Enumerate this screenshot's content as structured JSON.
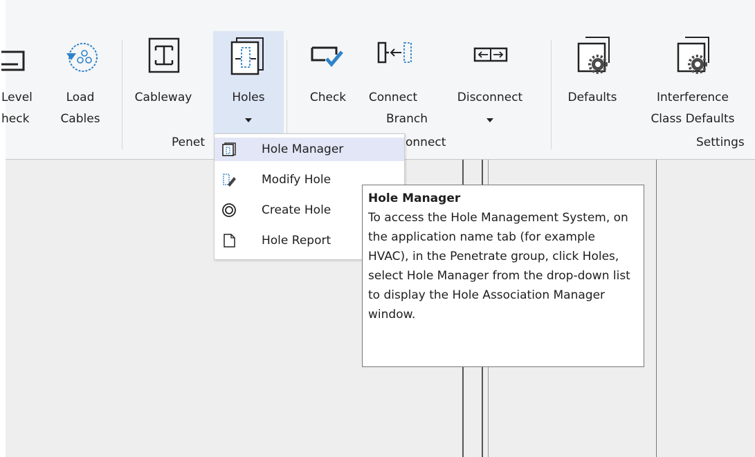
{
  "ribbon": {
    "buttons": {
      "level_check": {
        "lines": [
          "Level",
          "heck"
        ]
      },
      "load_cables": {
        "lines": [
          "Load",
          "Cables"
        ]
      },
      "cableway": {
        "lines": [
          "Cableway"
        ]
      },
      "holes": {
        "lines": [
          "Holes"
        ]
      },
      "check": {
        "lines": [
          "Check"
        ]
      },
      "connect_branch": {
        "lines": [
          "Connect",
          "Branch"
        ]
      },
      "disconnect": {
        "lines": [
          "Disconnect"
        ]
      },
      "defaults": {
        "lines": [
          "Defaults"
        ]
      },
      "interference": {
        "lines": [
          "Interference",
          "Class Defaults"
        ]
      }
    },
    "groups": {
      "penetrate": "Penet",
      "connect": "onnect",
      "settings": "Settings"
    }
  },
  "holes_menu": {
    "items": [
      {
        "label": "Hole Manager",
        "icon": "hole-manager-icon",
        "highlighted": true
      },
      {
        "label": "Modify Hole",
        "icon": "modify-hole-icon"
      },
      {
        "label": "Create Hole",
        "icon": "create-hole-icon"
      },
      {
        "label": "Hole Report",
        "icon": "hole-report-icon"
      }
    ]
  },
  "tooltip": {
    "title": "Hole Manager",
    "body": "To access the Hole Management System, on the application name tab (for example HVAC), in the Penetrate group, click Holes, select Hole Manager from the drop-down list to display the Hole Association Manager window."
  },
  "colors": {
    "ribbon_bg": "#f5f6f7",
    "selected_button_bg": "#dde6f5",
    "menu_highlight": "#e3e6f6",
    "accent_blue": "#2f83c9"
  }
}
